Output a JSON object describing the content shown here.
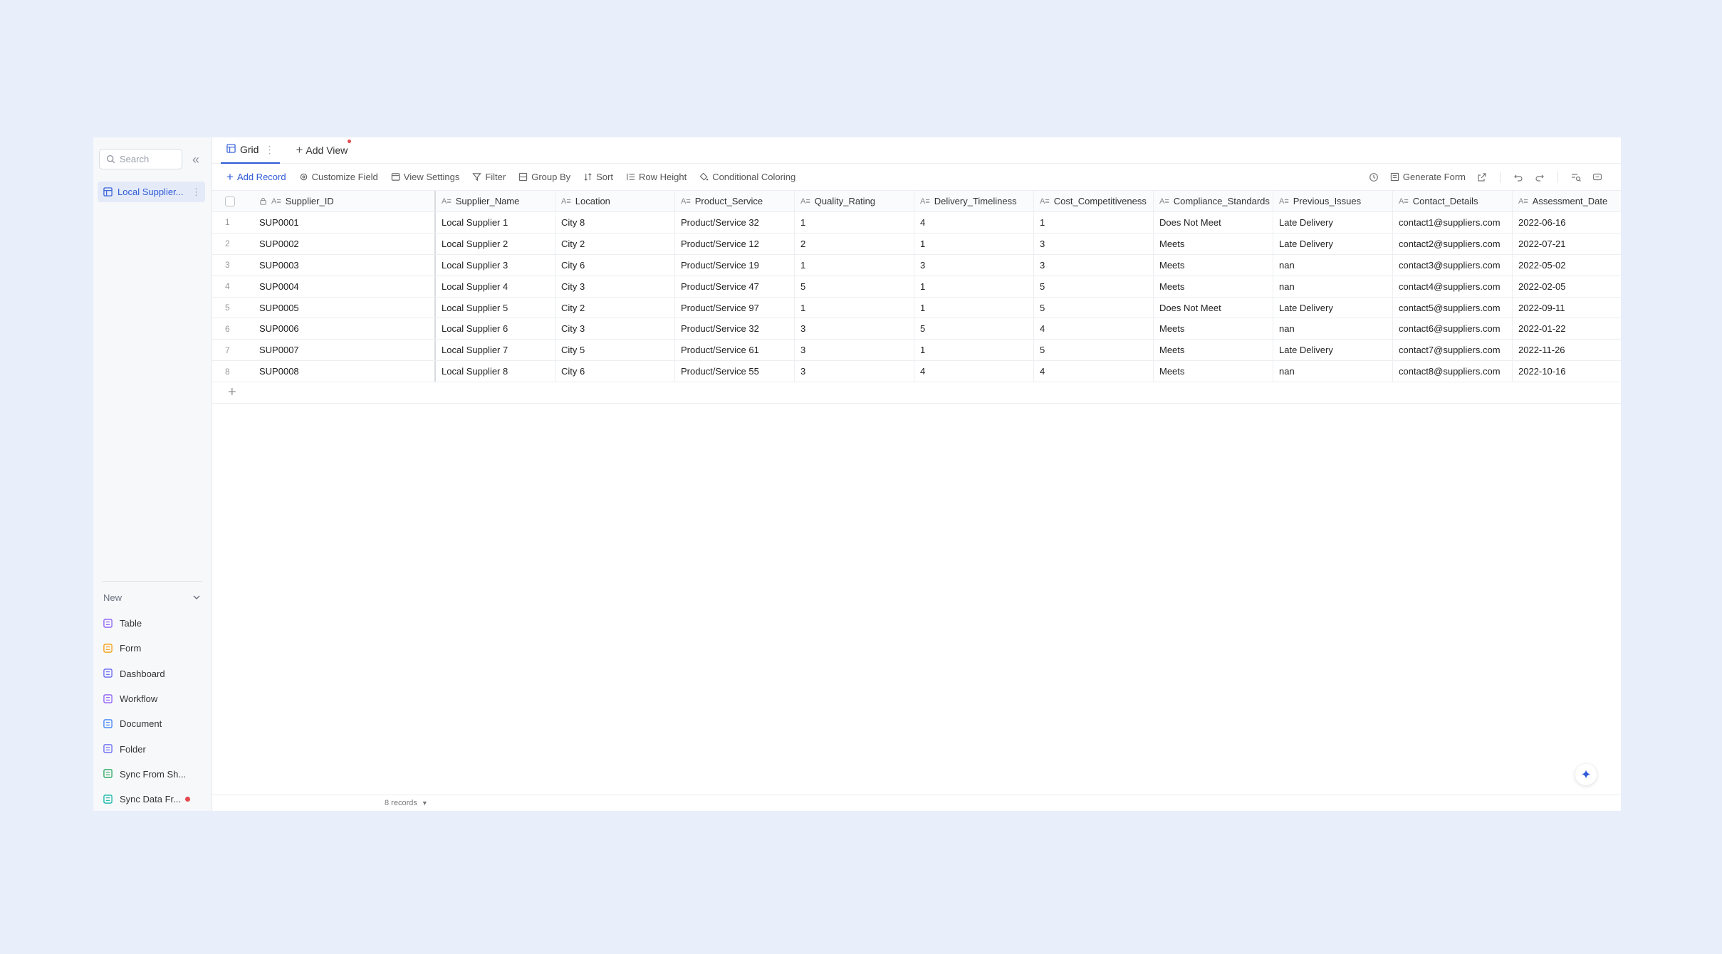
{
  "sidebar": {
    "search_placeholder": "Search",
    "collapse_icon": "«",
    "table_item": "Local Supplier...",
    "new_label": "New",
    "new_items": [
      {
        "label": "Table",
        "color": "#8b5cf6"
      },
      {
        "label": "Form",
        "color": "#f59e0b"
      },
      {
        "label": "Dashboard",
        "color": "#6366f1"
      },
      {
        "label": "Workflow",
        "color": "#8b5cf6"
      },
      {
        "label": "Document",
        "color": "#3b82f6"
      },
      {
        "label": "Folder",
        "color": "#6366f1"
      },
      {
        "label": "Sync From Sh...",
        "color": "#22a55a"
      },
      {
        "label": "Sync Data Fr...",
        "color": "#14b8a6"
      }
    ]
  },
  "tabs": {
    "grid": "Grid",
    "add_view": "Add View"
  },
  "toolbar": {
    "add_record": "Add Record",
    "customize_field": "Customize Field",
    "view_settings": "View Settings",
    "filter": "Filter",
    "group_by": "Group By",
    "sort": "Sort",
    "row_height": "Row Height",
    "conditional_coloring": "Conditional Coloring",
    "generate_form": "Generate Form"
  },
  "grid": {
    "columns": [
      "Supplier_ID",
      "Supplier_Name",
      "Location",
      "Product_Service",
      "Quality_Rating",
      "Delivery_Timeliness",
      "Cost_Competitiveness",
      "Compliance_Standards",
      "Previous_Issues",
      "Contact_Details",
      "Assessment_Date"
    ],
    "rows": [
      [
        "SUP0001",
        "Local Supplier 1",
        "City 8",
        "Product/Service 32",
        "1",
        "4",
        "1",
        "Does Not Meet",
        "Late Delivery",
        "contact1@suppliers.com",
        "2022-06-16"
      ],
      [
        "SUP0002",
        "Local Supplier 2",
        "City 2",
        "Product/Service 12",
        "2",
        "1",
        "3",
        "Meets",
        "Late Delivery",
        "contact2@suppliers.com",
        "2022-07-21"
      ],
      [
        "SUP0003",
        "Local Supplier 3",
        "City 6",
        "Product/Service 19",
        "1",
        "3",
        "3",
        "Meets",
        "nan",
        "contact3@suppliers.com",
        "2022-05-02"
      ],
      [
        "SUP0004",
        "Local Supplier 4",
        "City 3",
        "Product/Service 47",
        "5",
        "1",
        "5",
        "Meets",
        "nan",
        "contact4@suppliers.com",
        "2022-02-05"
      ],
      [
        "SUP0005",
        "Local Supplier 5",
        "City 2",
        "Product/Service 97",
        "1",
        "1",
        "5",
        "Does Not Meet",
        "Late Delivery",
        "contact5@suppliers.com",
        "2022-09-11"
      ],
      [
        "SUP0006",
        "Local Supplier 6",
        "City 3",
        "Product/Service 32",
        "3",
        "5",
        "4",
        "Meets",
        "nan",
        "contact6@suppliers.com",
        "2022-01-22"
      ],
      [
        "SUP0007",
        "Local Supplier 7",
        "City 5",
        "Product/Service 61",
        "3",
        "1",
        "5",
        "Meets",
        "Late Delivery",
        "contact7@suppliers.com",
        "2022-11-26"
      ],
      [
        "SUP0008",
        "Local Supplier 8",
        "City 6",
        "Product/Service 55",
        "3",
        "4",
        "4",
        "Meets",
        "nan",
        "contact8@suppliers.com",
        "2022-10-16"
      ]
    ],
    "add_row_symbol": "+"
  },
  "footer": {
    "record_count": "8 records"
  },
  "colors": {
    "accent": "#2f5bd6",
    "background": "#e9eefb"
  }
}
